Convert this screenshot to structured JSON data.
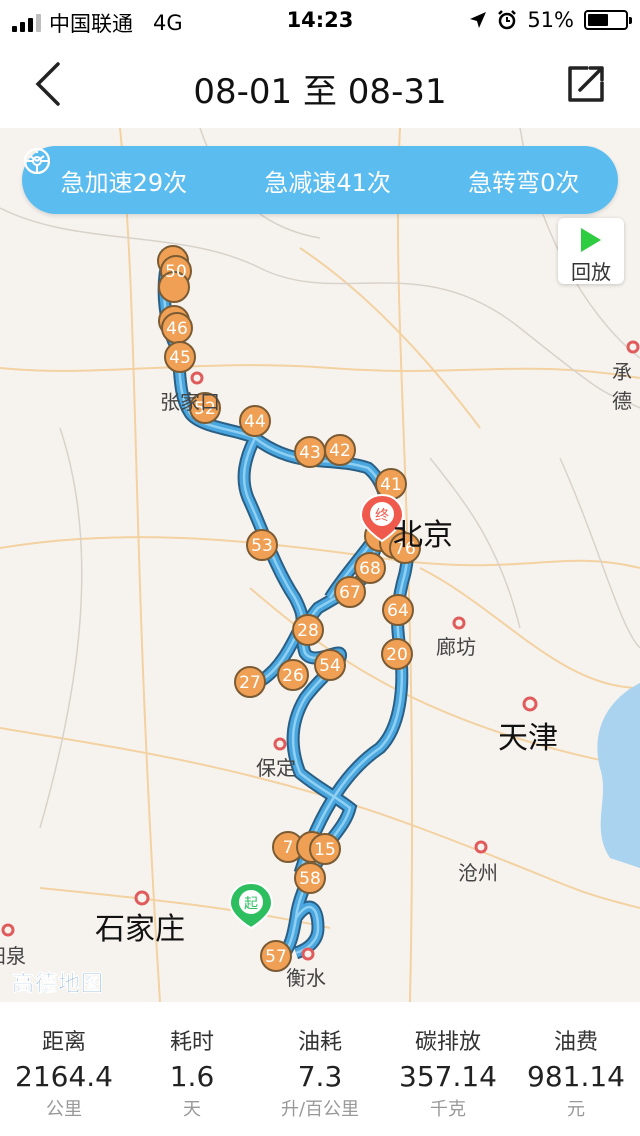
{
  "status": {
    "carrier": "中国联通",
    "network": "4G",
    "time": "14:23",
    "battery": "51%"
  },
  "header": {
    "title": "08-01 至 08-31",
    "back_icon": "chevron-left-icon",
    "share_icon": "share-icon"
  },
  "events": [
    {
      "label": "急加速29次",
      "icon": "speedometer-icon"
    },
    {
      "label": "急减速41次",
      "icon": "speedometer-icon"
    },
    {
      "label": "急转弯0次",
      "icon": "steering-wheel-icon"
    }
  ],
  "replay": {
    "label": "回放"
  },
  "map": {
    "route_color": "#4aa6de",
    "marker_color": "#f0a055",
    "start_label": "起",
    "end_label": "终",
    "logo": "高德地图",
    "cities": [
      {
        "name": "张家口"
      },
      {
        "name": "北京"
      },
      {
        "name": "承德"
      },
      {
        "name": "廊坊"
      },
      {
        "name": "天津"
      },
      {
        "name": "保定"
      },
      {
        "name": "沧州"
      },
      {
        "name": "石家庄"
      },
      {
        "name": "衡水"
      },
      {
        "name": "阳泉"
      }
    ],
    "markers": [
      "50",
      "46",
      "45",
      "52",
      "44",
      "43",
      "42",
      "41",
      "76",
      "68",
      "67",
      "64",
      "53",
      "28",
      "54",
      "20",
      "27",
      "26",
      "7",
      "15",
      "58",
      "57"
    ]
  },
  "stats": [
    {
      "label": "距离",
      "value": "2164.4",
      "unit": "公里"
    },
    {
      "label": "耗时",
      "value": "1.6",
      "unit": "天"
    },
    {
      "label": "油耗",
      "value": "7.3",
      "unit": "升/百公里"
    },
    {
      "label": "碳排放",
      "value": "357.14",
      "unit": "千克"
    },
    {
      "label": "油费",
      "value": "981.14",
      "unit": "元"
    }
  ]
}
